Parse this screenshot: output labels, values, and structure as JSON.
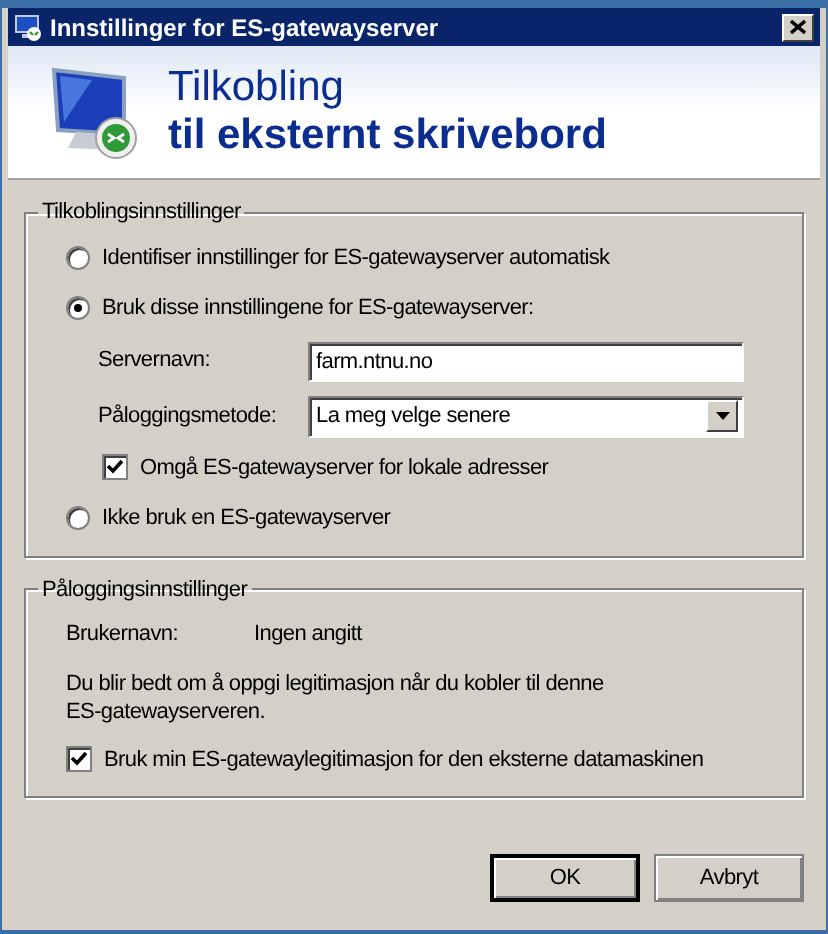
{
  "window": {
    "title": "Innstillinger for ES-gatewayserver"
  },
  "header": {
    "line1": "Tilkobling",
    "line2": "til eksternt skrivebord"
  },
  "connection_settings": {
    "legend": "Tilkoblingsinnstillinger",
    "options": [
      {
        "label": "Identifiser innstillinger for ES-gatewayserver automatisk",
        "selected": false
      },
      {
        "label": "Bruk disse innstillingene for ES-gatewayserver:",
        "selected": true,
        "details": {
          "server_name": {
            "label": "Servernavn:",
            "value": "farm.ntnu.no"
          },
          "logon_method": {
            "label": "Påloggingsmetode:",
            "value": "La meg velge senere"
          },
          "bypass_local": {
            "label": "Omgå ES-gatewayserver for lokale adresser",
            "checked": true
          }
        }
      },
      {
        "label": "Ikke bruk en ES-gatewayserver",
        "selected": false
      }
    ]
  },
  "logon_settings": {
    "legend": "Påloggingsinnstillinger",
    "username_label": "Brukernavn:",
    "username_value": "Ingen angitt",
    "note": "Du blir bedt om å oppgi legitimasjon når du kobler til denne ES-gatewayserveren.",
    "use_credentials": {
      "label": "Bruk min ES-gatewaylegitimasjon for den eksterne datamaskinen",
      "checked": true
    }
  },
  "buttons": [
    {
      "label": "OK",
      "default": true
    },
    {
      "label": "Avbryt",
      "default": false
    }
  ]
}
